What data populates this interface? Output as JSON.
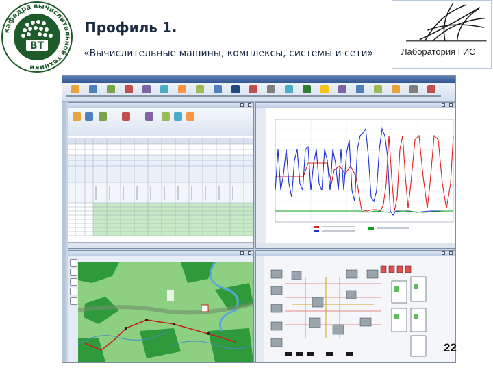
{
  "header": {
    "title": "Профиль 1.",
    "subtitle": "«Вычислительные машины, комплексы, системы и сети»",
    "page_number": "22"
  },
  "logo_left": {
    "ring_text": "кафедра вычислительной техники",
    "monogram": "ВТ",
    "ring_color": "#1f5a2b"
  },
  "logo_right": {
    "lab_name": "Лаборатория ГИС"
  },
  "colors": {
    "accent": "#2f5c95",
    "series_red": "#e02020",
    "series_blue": "#2030d0",
    "series_green": "#10a020",
    "map_green": "#2f9a3c"
  },
  "icons": [
    "save-icon",
    "print-icon",
    "search-icon",
    "gear-icon",
    "close-icon",
    "minimize-icon",
    "maximize-icon",
    "zoom-icon",
    "pan-icon",
    "pointer-icon"
  ]
}
